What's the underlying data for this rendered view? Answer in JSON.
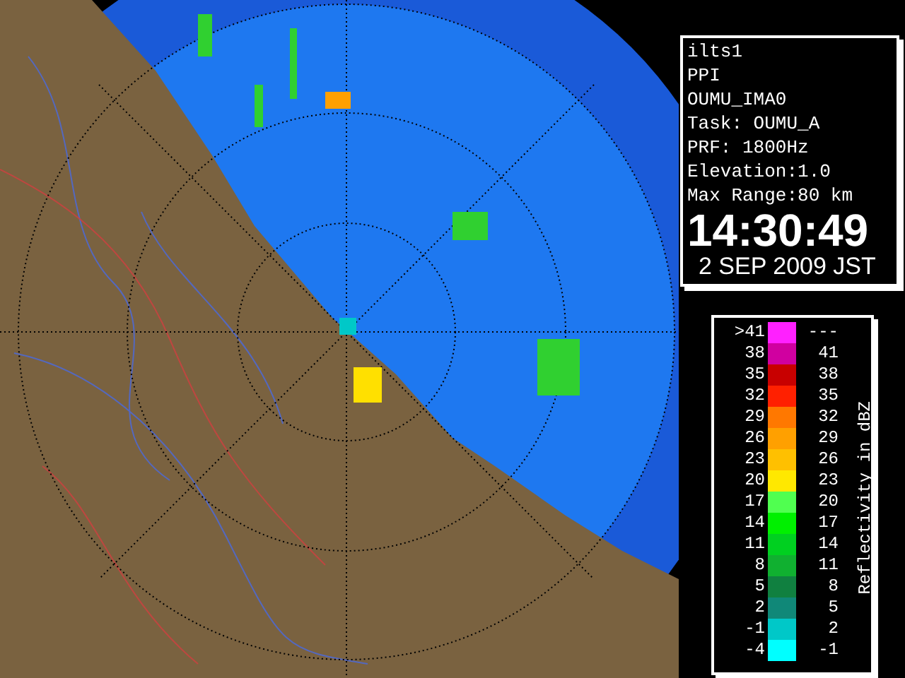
{
  "info_panel": {
    "lines": [
      "ilts1",
      "PPI",
      "OUMU_IMA0",
      "Task: OUMU_A",
      "PRF: 1800Hz",
      "Elevation:1.0",
      "Max Range:80 km"
    ],
    "time": "14:30:49",
    "date": "2 SEP 2009 JST"
  },
  "legend": {
    "title": "Reflectivity in dBZ",
    "rows": [
      {
        "low": ">41",
        "high": "---",
        "color": "#ff20ff"
      },
      {
        "low": "38",
        "high": "41",
        "color": "#d000a0"
      },
      {
        "low": "35",
        "high": "38",
        "color": "#c80000"
      },
      {
        "low": "32",
        "high": "35",
        "color": "#ff2000"
      },
      {
        "low": "29",
        "high": "32",
        "color": "#ff7800"
      },
      {
        "low": "26",
        "high": "29",
        "color": "#ffa000"
      },
      {
        "low": "23",
        "high": "26",
        "color": "#ffc000"
      },
      {
        "low": "20",
        "high": "23",
        "color": "#ffe800"
      },
      {
        "low": "17",
        "high": "20",
        "color": "#50ff50"
      },
      {
        "low": "14",
        "high": "17",
        "color": "#00f000"
      },
      {
        "low": "11",
        "high": "14",
        "color": "#00d020"
      },
      {
        "low": "8",
        "high": "11",
        "color": "#10b030"
      },
      {
        "low": "5",
        "high": "8",
        "color": "#108040"
      },
      {
        "low": "2",
        "high": "5",
        "color": "#108878"
      },
      {
        "low": "-1",
        "high": "2",
        "color": "#00c8c8"
      },
      {
        "low": "-4",
        "high": "-1",
        "color": "#00ffff"
      }
    ]
  }
}
